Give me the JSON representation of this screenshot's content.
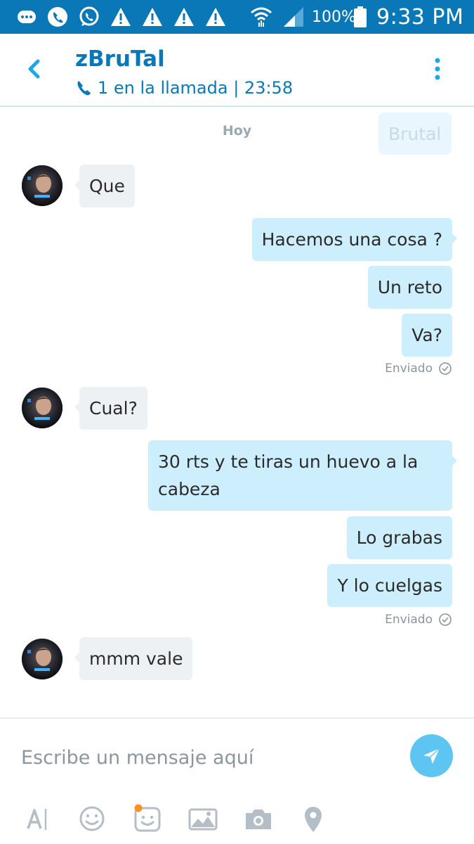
{
  "status_bar": {
    "battery_percent": "100%",
    "time": "9:33 PM"
  },
  "header": {
    "contact_name": "zBruTal",
    "call_status": "1 en la llamada | 23:58",
    "back_icon": "chevron-left-icon",
    "menu_icon": "more-vertical-icon"
  },
  "chat": {
    "date_separator": "Hoy",
    "partial_top_message": "Brutal",
    "messages": [
      {
        "from": "contact",
        "text": "Que"
      },
      {
        "from": "me",
        "text": "Hacemos una cosa ?"
      },
      {
        "from": "me",
        "text": "Un reto"
      },
      {
        "from": "me",
        "text": "Va?"
      },
      {
        "from": "contact",
        "text": "Cual?"
      },
      {
        "from": "me",
        "text": "30 rts y te tiras un huevo a la cabeza"
      },
      {
        "from": "me",
        "text": "Lo grabas"
      },
      {
        "from": "me",
        "text": "Y lo cuelgas"
      },
      {
        "from": "contact",
        "text": "mmm vale"
      }
    ],
    "receipts": [
      "Enviado",
      "Enviado"
    ]
  },
  "composer": {
    "placeholder": "Escribe un mensaje aquí",
    "send_icon": "send-icon",
    "toolbar_icons": [
      "text-format-icon",
      "emoji-icon",
      "moji-icon",
      "media-bar-icon",
      "camera-icon",
      "location-icon"
    ]
  },
  "colors": {
    "brand": "#0a78b7",
    "outgoing_bubble": "#cdeefd",
    "incoming_bubble": "#eef1f4",
    "send_button": "#5ec5f3",
    "notification_dot": "#f7931e"
  }
}
